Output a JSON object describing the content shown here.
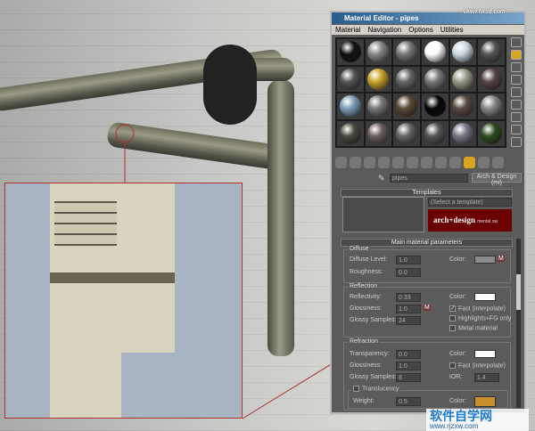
{
  "window": {
    "title": "Material Editor - pipes",
    "menu": [
      "Material",
      "Navigation",
      "Options",
      "Utilities"
    ]
  },
  "name_row": {
    "material_name": "pipes",
    "type_button": "Arch & Design (mi)"
  },
  "templates": {
    "header": "Templates",
    "select_placeholder": "(Select a template)",
    "logo_text": "arch+design",
    "logo_sub": "mental ray"
  },
  "main": {
    "header": "Main material parameters",
    "diffuse": {
      "title": "Diffuse",
      "level_label": "Diffuse Level:",
      "level": "1.0",
      "roughness_label": "Roughness:",
      "roughness": "0.0",
      "color_label": "Color:",
      "map_button": "M",
      "color": "#8a8a8a"
    },
    "reflection": {
      "title": "Reflection",
      "reflectivity_label": "Reflectivity:",
      "reflectivity": "0.33",
      "glossiness_label": "Glossiness:",
      "glossiness": "1.0",
      "map_button": "M",
      "samples_label": "Glossy Samples:",
      "samples": "24",
      "color_label": "Color:",
      "color": "#ffffff",
      "fast": "Fast (interpolate)",
      "fast_checked": true,
      "highlights": "Highlights+FG only",
      "highlights_checked": false,
      "metal": "Metal material",
      "metal_checked": false
    },
    "refraction": {
      "title": "Refraction",
      "transparency_label": "Transparency:",
      "transparency": "0.0",
      "glossiness_label": "Glossiness:",
      "glossiness": "1.0",
      "samples_label": "Glossy Samples:",
      "samples": "8",
      "color_label": "Color:",
      "color": "#ffffff",
      "fast": "Fast (interpolate)",
      "fast_checked": false,
      "ior_label": "IOR:",
      "ior": "1.4"
    },
    "translucency": {
      "title": "Translucency",
      "checked": false,
      "weight_label": "Weight:",
      "weight": "0.5",
      "color_label": "Color:",
      "color": "#c8902c"
    }
  },
  "watermarks": {
    "top": "www.hxsd.com",
    "bottom_title": "软件自学网",
    "bottom_url": "www.rjzxw.com"
  },
  "colors": {
    "accent_line": "#b03030"
  }
}
